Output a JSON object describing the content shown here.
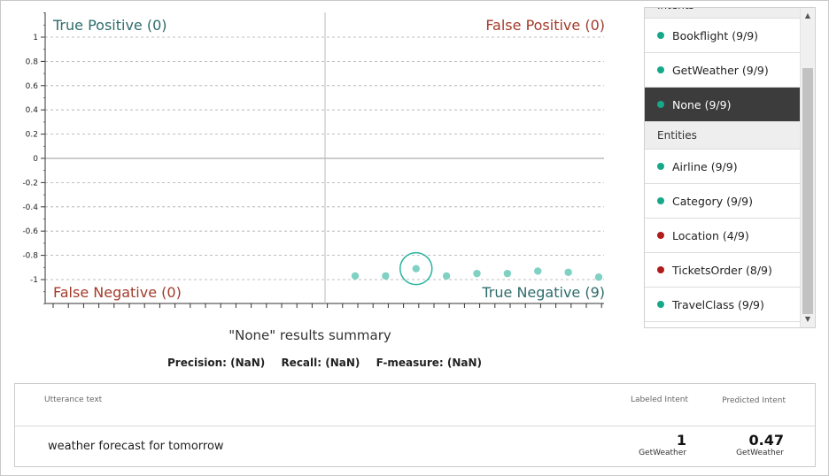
{
  "quadrants": {
    "true_positive": "True Positive (0)",
    "false_positive": "False Positive (0)",
    "false_negative": "False Negative (0)",
    "true_negative": "True Negative (9)"
  },
  "colors": {
    "positive": "#2e6b6b",
    "negative": "#a33a2a",
    "point": "#7fd1c3",
    "highlight_ring": "#2bb3a0",
    "dot_ok": "#17a88a",
    "dot_bad": "#b01c1c"
  },
  "chart_data": {
    "type": "scatter",
    "y_ticks": [
      "1",
      "0.8",
      "0.6",
      "0.4",
      "0.2",
      "0",
      "-0.2",
      "-0.4",
      "-0.6",
      "-0.8",
      "-1"
    ],
    "ylim": [
      -1.2,
      1.2
    ],
    "x_count": 9,
    "points": [
      -0.97,
      -0.97,
      -0.91,
      -0.97,
      -0.95,
      -0.95,
      -0.93,
      -0.94,
      -0.98
    ],
    "selected_index": 2
  },
  "summary": {
    "title": "\"None\" results summary",
    "precision": "Precision: (NaN)",
    "recall": "Recall: (NaN)",
    "fmeasure": "F-measure: (NaN)"
  },
  "sidebar": {
    "intents_header": "Intents",
    "entities_header": "Entities",
    "intents": [
      {
        "label": "Bookflight (9/9)",
        "status": "ok",
        "selected": false
      },
      {
        "label": "GetWeather (9/9)",
        "status": "ok",
        "selected": false
      },
      {
        "label": "None (9/9)",
        "status": "ok",
        "selected": true
      }
    ],
    "entities": [
      {
        "label": "Airline (9/9)",
        "status": "ok"
      },
      {
        "label": "Category (9/9)",
        "status": "ok"
      },
      {
        "label": "Location (4/9)",
        "status": "bad"
      },
      {
        "label": "TicketsOrder (8/9)",
        "status": "bad"
      },
      {
        "label": "TravelClass (9/9)",
        "status": "ok"
      }
    ],
    "scroll_up": "▲",
    "scroll_down": "▼"
  },
  "table": {
    "headers": {
      "utterance": "Utterance text",
      "labeled": "Labeled Intent",
      "predicted": "Predicted Intent"
    },
    "rows": [
      {
        "utterance": "weather forecast for tomorrow",
        "labeled_value": "1",
        "labeled_intent": "GetWeather",
        "predicted_value": "0.47",
        "predicted_intent": "GetWeather"
      }
    ]
  }
}
